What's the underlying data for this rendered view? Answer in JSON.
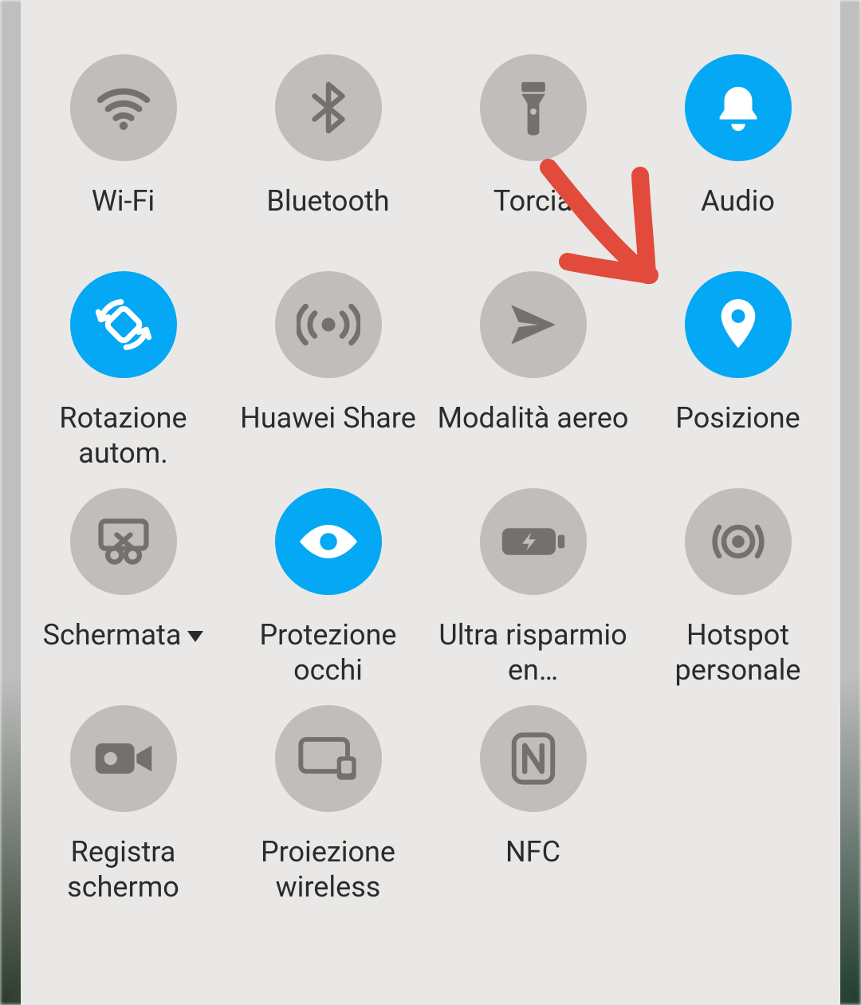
{
  "colors": {
    "accent": "#05a8f4",
    "iconOff": "#737170",
    "iconOn": "#ffffff",
    "label": "#2b2b2b"
  },
  "tiles": [
    {
      "id": "wifi",
      "label": "Wi-Fi",
      "active": false,
      "icon": "wifi-icon"
    },
    {
      "id": "bluetooth",
      "label": "Bluetooth",
      "active": false,
      "icon": "bluetooth-icon"
    },
    {
      "id": "torch",
      "label": "Torcia",
      "active": false,
      "icon": "flashlight-icon"
    },
    {
      "id": "audio",
      "label": "Audio",
      "active": true,
      "icon": "bell-icon"
    },
    {
      "id": "autorotate",
      "label": "Rotazione autom.",
      "active": true,
      "icon": "rotate-icon"
    },
    {
      "id": "huaweishare",
      "label": "Huawei Share",
      "active": false,
      "icon": "broadcast-icon"
    },
    {
      "id": "airplane",
      "label": "Modalità aereo",
      "active": false,
      "icon": "airplane-icon"
    },
    {
      "id": "location",
      "label": "Posizione",
      "active": true,
      "icon": "location-pin-icon"
    },
    {
      "id": "screenshot",
      "label": "Schermata",
      "active": false,
      "icon": "screenshot-icon",
      "dropdown": true
    },
    {
      "id": "eyecare",
      "label": "Protezione occhi",
      "active": true,
      "icon": "eye-icon"
    },
    {
      "id": "powersave",
      "label": "Ultra risparmio en…",
      "active": false,
      "icon": "battery-saver-icon"
    },
    {
      "id": "hotspot",
      "label": "Hotspot personale",
      "active": false,
      "icon": "hotspot-icon"
    },
    {
      "id": "screenrec",
      "label": "Registra schermo",
      "active": false,
      "icon": "screen-record-icon"
    },
    {
      "id": "cast",
      "label": "Proiezione wireless",
      "active": false,
      "icon": "cast-icon"
    },
    {
      "id": "nfc",
      "label": "NFC",
      "active": false,
      "icon": "nfc-icon"
    }
  ]
}
